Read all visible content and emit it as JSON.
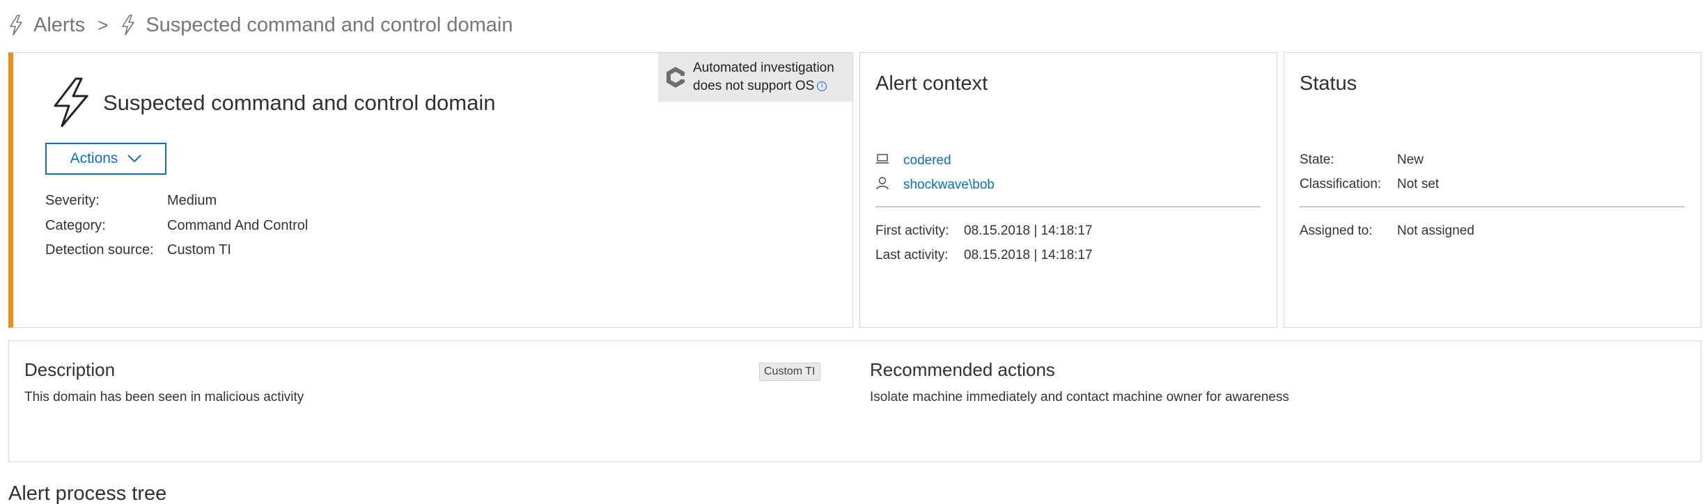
{
  "breadcrumb": {
    "root": "Alerts",
    "current": "Suspected command and control domain"
  },
  "alert": {
    "title": "Suspected command and control domain",
    "actions_label": "Actions",
    "severity_label": "Severity:",
    "severity_value": "Medium",
    "category_label": "Category:",
    "category_value": "Command And Control",
    "detection_label": "Detection source:",
    "detection_value": "Custom TI",
    "accent_color": "#ef8d1a",
    "automated_banner_line1": "Automated investigation",
    "automated_banner_line2": "does not support OS",
    "automated_banner_info": "i"
  },
  "context": {
    "heading": "Alert context",
    "machine": "codered",
    "user": "shockwave\\bob",
    "first_activity_label": "First activity:",
    "first_activity_value": "08.15.2018 | 14:18:17",
    "last_activity_label": "Last activity:",
    "last_activity_value": "08.15.2018 | 14:18:17"
  },
  "status": {
    "heading": "Status",
    "state_label": "State:",
    "state_value": "New",
    "classification_label": "Classification:",
    "classification_value": "Not set",
    "assigned_label": "Assigned to:",
    "assigned_value": "Not assigned"
  },
  "description": {
    "heading": "Description",
    "text": "This domain has been seen in malicious activity",
    "tag": "Custom TI"
  },
  "recommended": {
    "heading": "Recommended actions",
    "text": "Isolate machine immediately and contact machine owner for awareness"
  },
  "process_tree": {
    "heading": "Alert process tree"
  },
  "icons": {
    "breadcrumb": "lightning-bolt-icon",
    "alert": "lightning-bolt-icon",
    "banner": "hexagon-investigation-icon",
    "machine": "laptop-icon",
    "user": "person-icon",
    "chevron": "chevron-down-icon"
  },
  "colors": {
    "link": "#0b6fc4",
    "accent": "#ef8d1a"
  }
}
